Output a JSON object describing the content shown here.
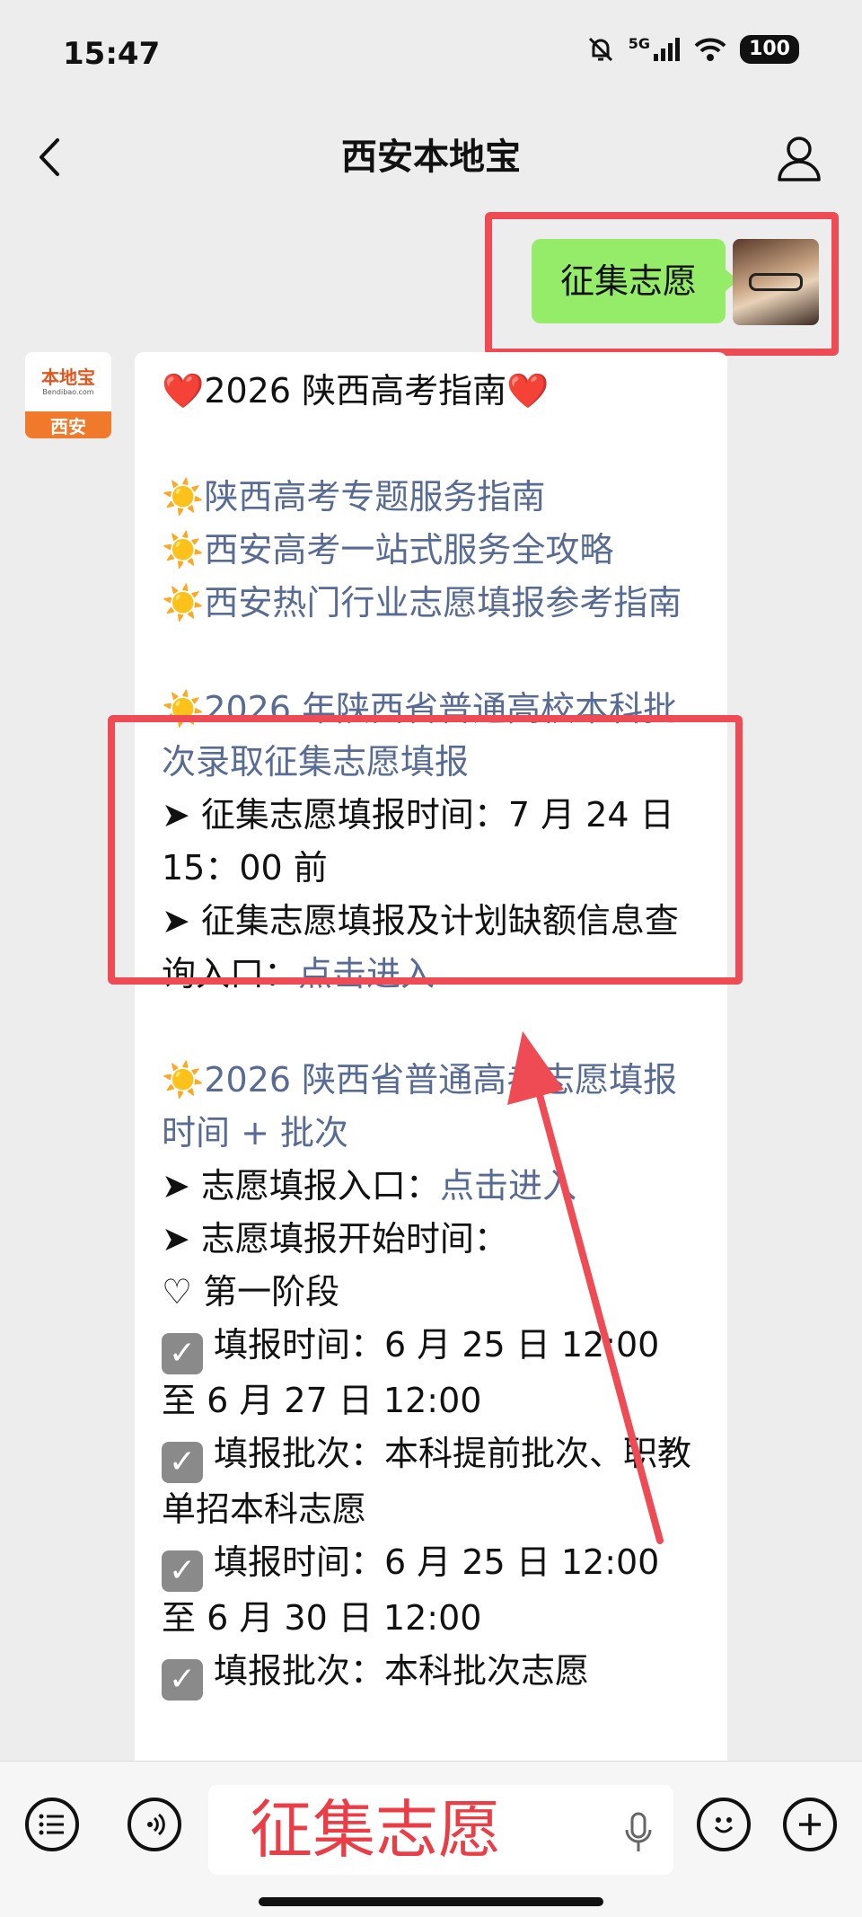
{
  "status_bar": {
    "time": "15:47",
    "network": "5G",
    "battery": "100",
    "icons": [
      "mute-bell-icon",
      "signal-icon",
      "wifi-icon",
      "battery-icon"
    ]
  },
  "header": {
    "title": "西安本地宝",
    "back_icon": "chevron-left-icon",
    "profile_icon": "person-icon"
  },
  "sent_message": {
    "text": "征集志愿"
  },
  "bot": {
    "avatar_main": "本地宝",
    "avatar_sub": "Bendibao.com",
    "avatar_city": "西安"
  },
  "received_message": {
    "heading": "❤️2026 陕西高考指南❤️",
    "guides": [
      "陕西高考专题服务指南",
      "西安高考一站式服务全攻略",
      "西安热门行业志愿填报参考指南"
    ],
    "section1_title": "2026 年陕西省普通高校本科批次录取征集志愿填报",
    "section1_time_label": "征集志愿填报时间：7 月 24 日 15：00 前",
    "section1_query_label": "征集志愿填报及计划缺额信息查询入口：",
    "section1_link": "点击进入",
    "section2_title": "2026 陕西省普通高考志愿填报时间 + 批次",
    "entry_label": "志愿填报入口：",
    "entry_link": "点击进入",
    "start_label": "志愿填报开始时间：",
    "phase_label": "♡ 第一阶段",
    "checks": [
      "填报时间：6 月 25 日 12:00 至 6 月 27 日 12:00",
      "填报批次：本科提前批次、职教单招本科志愿",
      "填报时间：6 月 25 日 12:00 至 6 月 30 日 12:00",
      "填报批次：本科批次志愿"
    ]
  },
  "input_bar": {
    "value": "征集志愿",
    "icons": [
      "list-icon",
      "voice-icon",
      "mic-icon",
      "emoji-icon",
      "plus-icon"
    ]
  },
  "colors": {
    "background": "#ededed",
    "sent_bubble": "#95ec69",
    "link": "#576b95",
    "highlight": "#ef4b55",
    "input_text": "#ea3d45"
  }
}
